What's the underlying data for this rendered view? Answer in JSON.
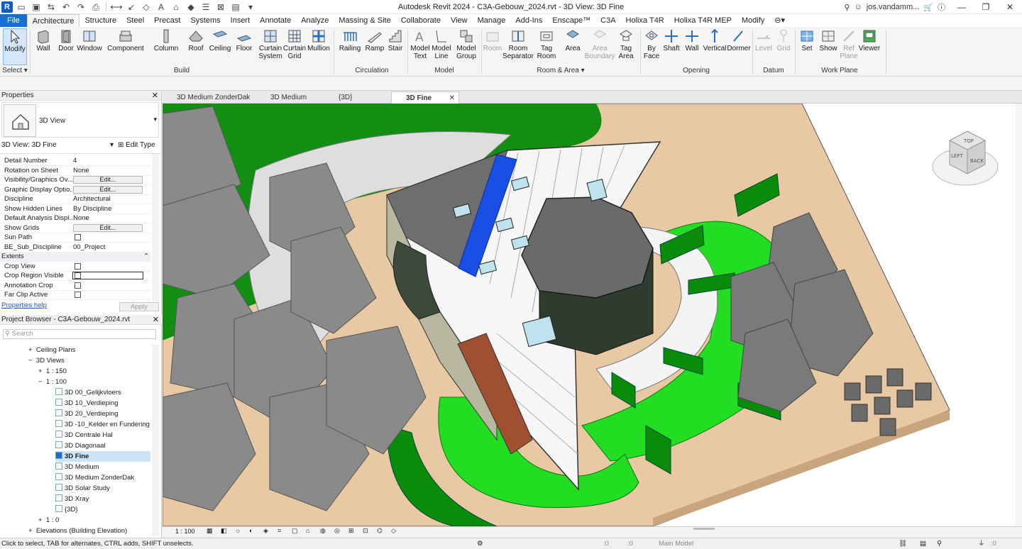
{
  "app": {
    "title": "Autodesk Revit 2024 - C3A-Gebouw_2024.rvt - 3D View: 3D Fine",
    "user": "jos.vandamm...",
    "logo_letter": "R"
  },
  "tabs": [
    "File",
    "Architecture",
    "Structure",
    "Steel",
    "Precast",
    "Systems",
    "Insert",
    "Annotate",
    "Analyze",
    "Massing & Site",
    "Collaborate",
    "View",
    "Manage",
    "Add-Ins",
    "Enscape™",
    "C3A",
    "Holixa T4R",
    "Holixa T4R MEP",
    "Modify"
  ],
  "ribbon": {
    "select": {
      "modify": "Modify",
      "label": "Select"
    },
    "build": {
      "label": "Build",
      "items": [
        "Wall",
        "Door",
        "Window",
        "Component",
        "Column",
        "Roof",
        "Ceiling",
        "Floor",
        "Curtain System",
        "Curtain Grid",
        "Mullion"
      ]
    },
    "circulation": {
      "label": "Circulation",
      "items": [
        "Railing",
        "Ramp",
        "Stair"
      ]
    },
    "model": {
      "label": "Model",
      "items": [
        "Model Text",
        "Model Line",
        "Model Group"
      ]
    },
    "room": {
      "label": "Room & Area",
      "items": [
        "Room",
        "Room Separator",
        "Tag Room",
        "Area",
        "Area Boundary",
        "Tag Area"
      ]
    },
    "opening": {
      "label": "Opening",
      "items": [
        "By Face",
        "Shaft",
        "Wall",
        "Vertical",
        "Dormer"
      ]
    },
    "datum": {
      "label": "Datum",
      "items": [
        "Level",
        "Grid"
      ]
    },
    "workplane": {
      "label": "Work Plane",
      "items": [
        "Set",
        "Show",
        "Ref Plane",
        "Viewer"
      ]
    }
  },
  "properties": {
    "header": "Properties",
    "type_name": "3D View",
    "instance": "3D View: 3D Fine",
    "edit_type": "Edit Type",
    "rows": [
      {
        "name": "Detail Number",
        "value": "4"
      },
      {
        "name": "Rotation on Sheet",
        "value": "None"
      },
      {
        "name": "Visibility/Graphics Ov...",
        "value": "Edit..."
      },
      {
        "name": "Graphic Display Optio...",
        "value": "Edit..."
      },
      {
        "name": "Discipline",
        "value": "Architectural"
      },
      {
        "name": "Show Hidden Lines",
        "value": "By Discipline"
      },
      {
        "name": "Default Analysis Displ...",
        "value": "None"
      },
      {
        "name": "Show Grids",
        "value": "Edit..."
      },
      {
        "name": "Sun Path",
        "value": ""
      },
      {
        "name": "BE_Sub_Discipline",
        "value": "00_Project"
      }
    ],
    "extents_label": "Extents",
    "extents_rows": [
      {
        "name": "Crop View",
        "value": ""
      },
      {
        "name": "Crop Region Visible",
        "value": ""
      },
      {
        "name": "Annotation Crop",
        "value": ""
      },
      {
        "name": "Far Clip Active",
        "value": ""
      }
    ],
    "help": "Properties help",
    "apply": "Apply"
  },
  "browser": {
    "header": "Project Browser - C3A-Gebouw_2024.rvt",
    "search_placeholder": "Search",
    "nodes": {
      "ceiling": "Ceiling Plans",
      "views3d": "3D Views",
      "s150": "1 : 150",
      "s100": "1 : 100",
      "s10": "1 : 0",
      "elev": "Elevations (Building Elevation)"
    },
    "views": [
      "3D 00_Gelijkvloers",
      "3D 10_Verdieping",
      "3D 20_Verdieping",
      "3D -10_Kelder en Fundering",
      "3D Centrale Hal",
      "3D Diagonaal",
      "3D Fine",
      "3D Medium",
      "3D Medium ZonderDak",
      "3D Solar Study",
      "3D Xray",
      "{3D}"
    ]
  },
  "view_tabs": [
    "3D Medium ZonderDak",
    "3D Medium",
    "{3D}",
    "3D Fine"
  ],
  "viewcube": {
    "faces": [
      "TOP",
      "BACK",
      "LEFT"
    ]
  },
  "view_bar": {
    "scale": "1 : 100"
  },
  "status": {
    "text": "Click to select, TAB for alternates, CTRL adds, SHIFT unselects.",
    "model": "Main Model",
    "zero1": ":0",
    "zero2": ":0"
  },
  "colors": {
    "accent": "#1570d3",
    "grass": "#22dd22",
    "hedge": "#0a8c0a",
    "ground": "#e9c9a3",
    "tree": "#8c8c8c"
  }
}
